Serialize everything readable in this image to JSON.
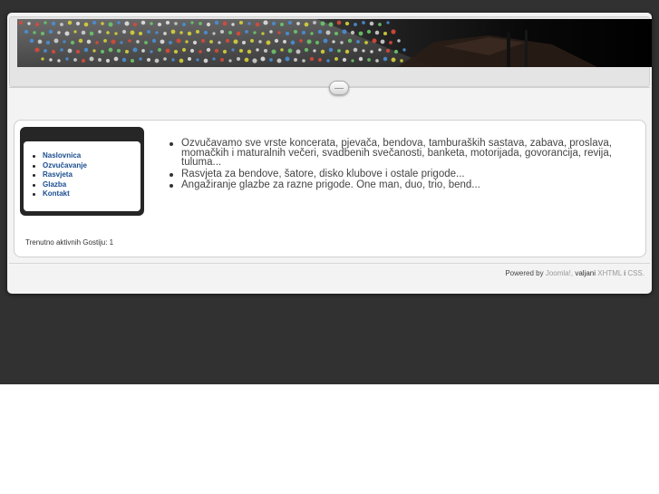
{
  "menu": {
    "items": [
      {
        "label": "Naslovnica"
      },
      {
        "label": "Ozvučavanje"
      },
      {
        "label": "Rasvjeta"
      },
      {
        "label": "Glazba"
      },
      {
        "label": "Kontakt"
      }
    ],
    "link_color": "#1a4d8f"
  },
  "guests_text": "Trenutno aktivnih Gostiju: 1",
  "services": [
    "Ozvučavamo sve vrste koncerata, pjevača, bendova, tamburaških sastava, zabava, proslava, momačkih i maturalnih večeri, svadbenih svečanosti, banketa, motorijada, govorancija, revija, tuluma...",
    "Rasvjeta za bendove, šatore, disko klubove i ostale prigode...",
    "Angažiranje glazbe za razne prigode. One man, duo, trio, bend..."
  ],
  "footer": {
    "powered_by": "Powered by",
    "joomla": "Joomla!",
    "valid": "valjani",
    "xhtml": "XHTML",
    "and": "i",
    "css": "CSS"
  },
  "colors": {
    "outer_background": "#313131",
    "page_background": "#f3f3f3",
    "menu_box": "#262626"
  }
}
